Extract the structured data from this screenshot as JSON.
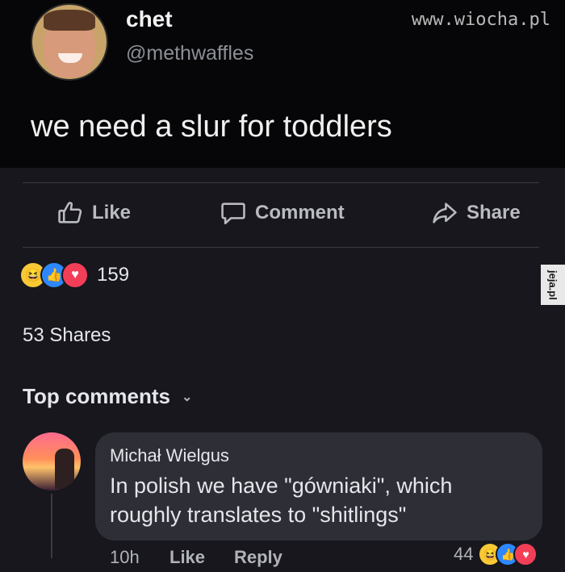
{
  "tweet": {
    "name": "chet",
    "handle": "@methwaffles",
    "text": "we need a slur for toddlers"
  },
  "watermark_top": "www.wiocha.pl",
  "side_watermark": "jeja.pl",
  "actions": {
    "like": "Like",
    "comment": "Comment",
    "share": "Share"
  },
  "reactions": {
    "count": "159",
    "icons": [
      "haha-reaction-icon",
      "like-reaction-icon",
      "love-reaction-icon"
    ]
  },
  "shares": "53 Shares",
  "top_comments": "Top comments",
  "comment": {
    "author": "Michał Wielgus",
    "text": "In polish we have \"gówniaki\", which roughly translates to \"shitlings\"",
    "time": "10h",
    "like": "Like",
    "reply": "Reply",
    "reaction_count": "44"
  },
  "colors": {
    "background": "#17171d",
    "tweet_background": "#060608",
    "bubble": "#2e2f36",
    "like_blue": "#2d88ff",
    "love_red": "#f33e58",
    "haha_yellow": "#f7c935"
  }
}
